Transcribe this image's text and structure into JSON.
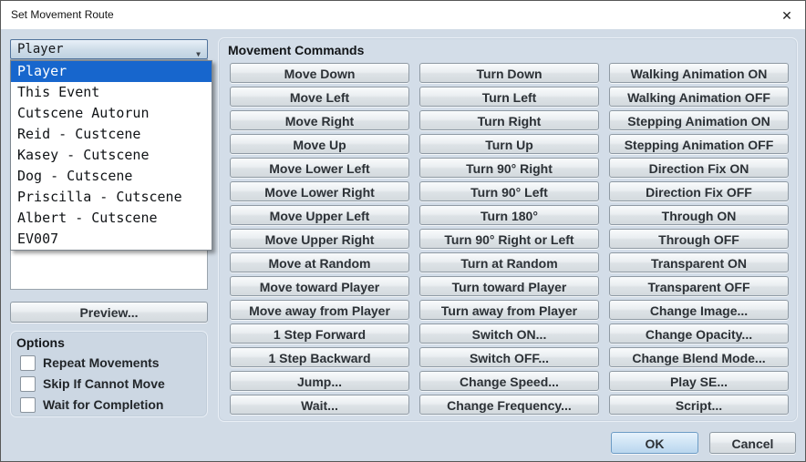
{
  "window": {
    "title": "Set Movement Route",
    "close_glyph": "✕"
  },
  "target_select": {
    "value": "Player",
    "arrow_glyph": "▼",
    "items": [
      {
        "label": "Player",
        "selected": true
      },
      {
        "label": "This Event",
        "selected": false
      },
      {
        "label": "Cutscene Autorun",
        "selected": false
      },
      {
        "label": "Reid - Custcene",
        "selected": false
      },
      {
        "label": "Kasey - Cutscene",
        "selected": false
      },
      {
        "label": "Dog - Cutscene",
        "selected": false
      },
      {
        "label": "Priscilla - Cutscene",
        "selected": false
      },
      {
        "label": "Albert - Cutscene",
        "selected": false
      },
      {
        "label": "EV007",
        "selected": false
      }
    ]
  },
  "movement_commands": {
    "title": "Movement Commands",
    "columns": {
      "col1": [
        "Move Down",
        "Move Left",
        "Move Right",
        "Move Up",
        "Move Lower Left",
        "Move Lower Right",
        "Move Upper Left",
        "Move Upper Right",
        "Move at Random",
        "Move toward Player",
        "Move away from Player",
        "1 Step Forward",
        "1 Step Backward",
        "Jump...",
        "Wait..."
      ],
      "col2": [
        "Turn Down",
        "Turn Left",
        "Turn Right",
        "Turn Up",
        "Turn 90° Right",
        "Turn 90° Left",
        "Turn 180°",
        "Turn 90° Right or Left",
        "Turn at Random",
        "Turn toward Player",
        "Turn away from Player",
        "Switch ON...",
        "Switch OFF...",
        "Change Speed...",
        "Change Frequency..."
      ],
      "col3": [
        "Walking Animation ON",
        "Walking Animation OFF",
        "Stepping Animation ON",
        "Stepping Animation OFF",
        "Direction Fix ON",
        "Direction Fix OFF",
        "Through ON",
        "Through OFF",
        "Transparent ON",
        "Transparent OFF",
        "Change Image...",
        "Change Opacity...",
        "Change Blend Mode...",
        "Play SE...",
        "Script..."
      ]
    }
  },
  "preview_button_label": "Preview...",
  "options": {
    "title": "Options",
    "checkboxes": [
      {
        "label": "Repeat Movements",
        "checked": false
      },
      {
        "label": "Skip If Cannot Move",
        "checked": false
      },
      {
        "label": "Wait for Completion",
        "checked": false
      }
    ]
  },
  "footer": {
    "ok_label": "OK",
    "cancel_label": "Cancel"
  },
  "colors": {
    "dialog_background": "#d1dbe6",
    "titlebar_background": "#ffffff",
    "selection_blue": "#1766cd",
    "ok_button_tint": "#cfe4f5"
  }
}
